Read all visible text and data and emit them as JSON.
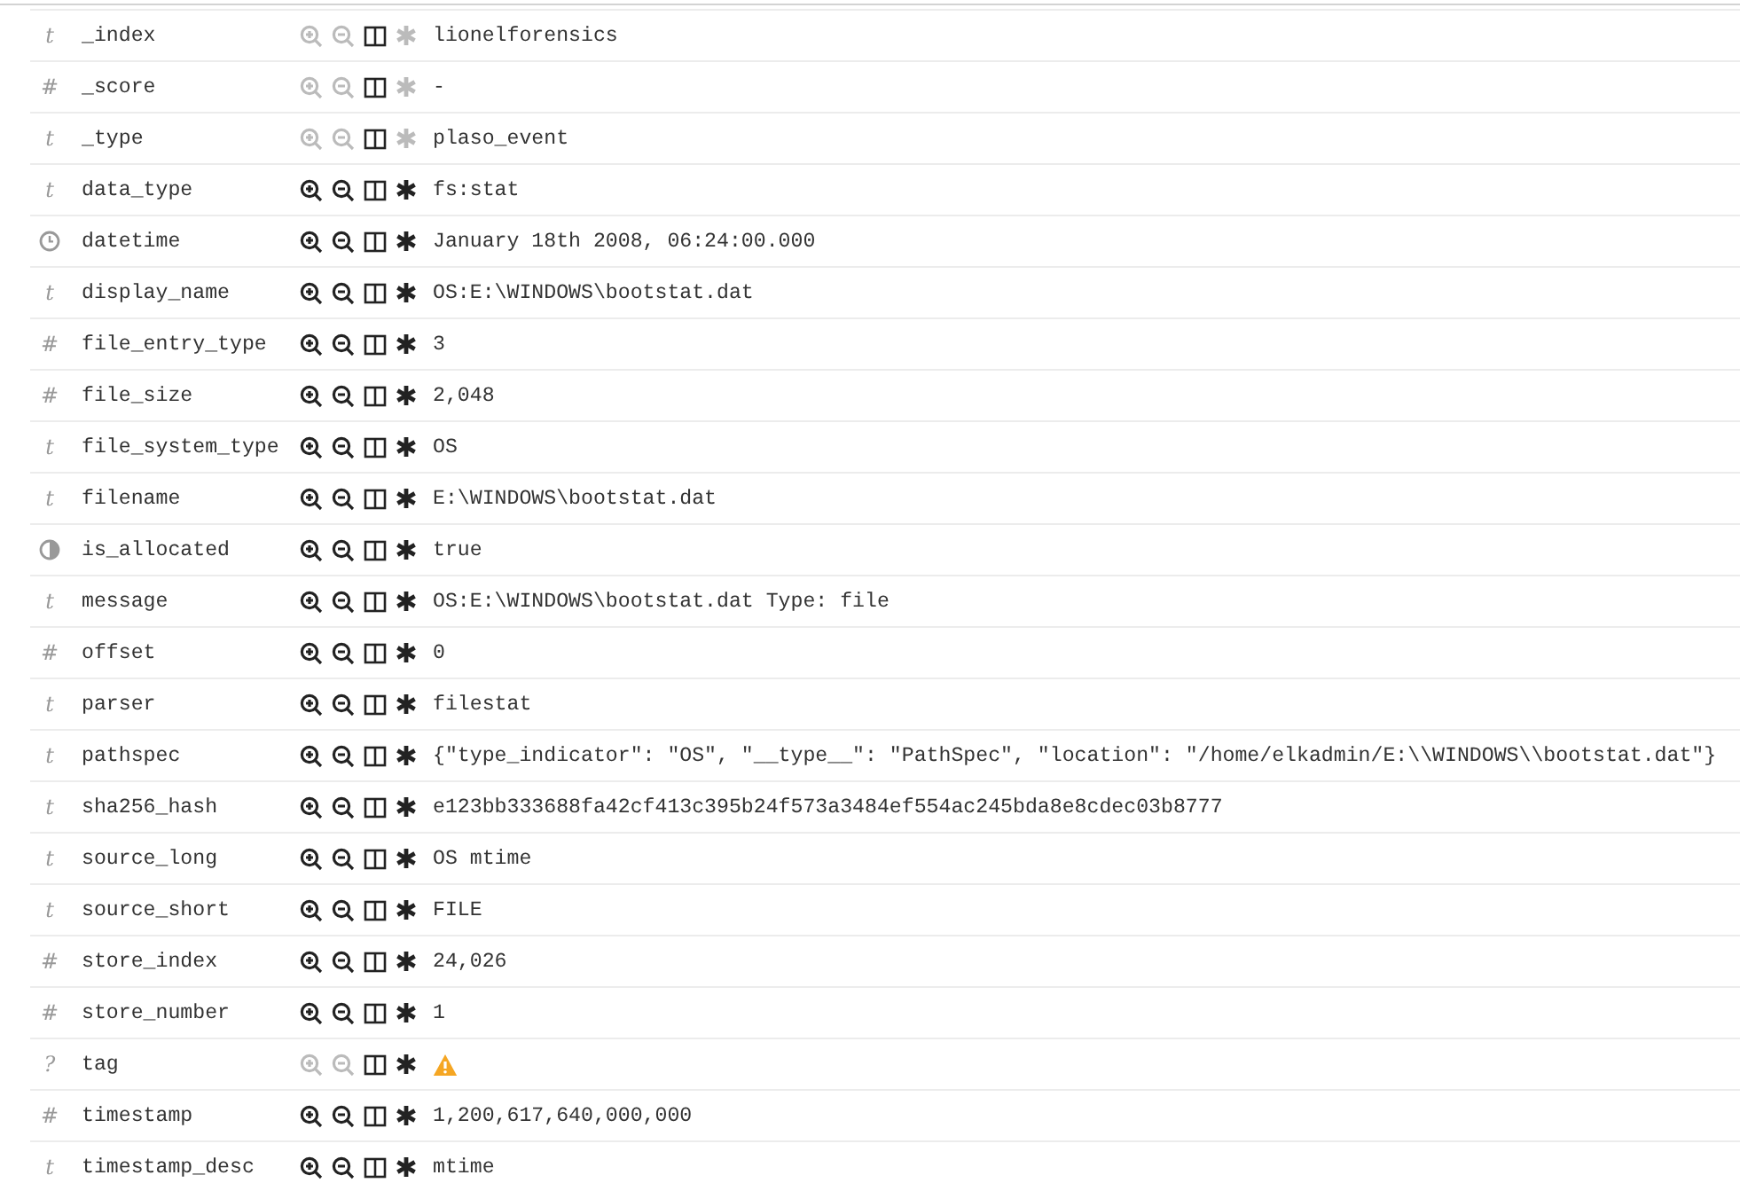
{
  "fields": [
    {
      "kind": "string",
      "type_label": "t",
      "name": "_index",
      "filter_disabled": true,
      "exists_disabled": true,
      "value": "lionelforensics"
    },
    {
      "kind": "number",
      "type_label": "#",
      "name": "_score",
      "filter_disabled": true,
      "exists_disabled": true,
      "value": "-"
    },
    {
      "kind": "string",
      "type_label": "t",
      "name": "_type",
      "filter_disabled": true,
      "exists_disabled": true,
      "value": "plaso_event"
    },
    {
      "kind": "string",
      "type_label": "t",
      "name": "data_type",
      "filter_disabled": false,
      "exists_disabled": false,
      "value": "fs:stat"
    },
    {
      "kind": "date",
      "name": "datetime",
      "filter_disabled": false,
      "exists_disabled": false,
      "value": "January 18th 2008, 06:24:00.000"
    },
    {
      "kind": "string",
      "type_label": "t",
      "name": "display_name",
      "filter_disabled": false,
      "exists_disabled": false,
      "value": "OS:E:\\WINDOWS\\bootstat.dat"
    },
    {
      "kind": "number",
      "type_label": "#",
      "name": "file_entry_type",
      "filter_disabled": false,
      "exists_disabled": false,
      "value": "3"
    },
    {
      "kind": "number",
      "type_label": "#",
      "name": "file_size",
      "filter_disabled": false,
      "exists_disabled": false,
      "value": "2,048"
    },
    {
      "kind": "string",
      "type_label": "t",
      "name": "file_system_type",
      "filter_disabled": false,
      "exists_disabled": false,
      "value": "OS"
    },
    {
      "kind": "string",
      "type_label": "t",
      "name": "filename",
      "filter_disabled": false,
      "exists_disabled": false,
      "value": "E:\\WINDOWS\\bootstat.dat"
    },
    {
      "kind": "boolean",
      "name": "is_allocated",
      "filter_disabled": false,
      "exists_disabled": false,
      "value": "true"
    },
    {
      "kind": "string",
      "type_label": "t",
      "name": "message",
      "filter_disabled": false,
      "exists_disabled": false,
      "value": "OS:E:\\WINDOWS\\bootstat.dat Type: file"
    },
    {
      "kind": "number",
      "type_label": "#",
      "name": "offset",
      "filter_disabled": false,
      "exists_disabled": false,
      "value": "0"
    },
    {
      "kind": "string",
      "type_label": "t",
      "name": "parser",
      "filter_disabled": false,
      "exists_disabled": false,
      "value": "filestat"
    },
    {
      "kind": "string",
      "type_label": "t",
      "name": "pathspec",
      "filter_disabled": false,
      "exists_disabled": false,
      "value": "{\"type_indicator\": \"OS\", \"__type__\": \"PathSpec\", \"location\": \"/home/elkadmin/E:\\\\WINDOWS\\\\bootstat.dat\"}"
    },
    {
      "kind": "string",
      "type_label": "t",
      "name": "sha256_hash",
      "filter_disabled": false,
      "exists_disabled": false,
      "value": "e123bb333688fa42cf413c395b24f573a3484ef554ac245bda8e8cdec03b8777"
    },
    {
      "kind": "string",
      "type_label": "t",
      "name": "source_long",
      "filter_disabled": false,
      "exists_disabled": false,
      "value": "OS mtime"
    },
    {
      "kind": "string",
      "type_label": "t",
      "name": "source_short",
      "filter_disabled": false,
      "exists_disabled": false,
      "value": "FILE"
    },
    {
      "kind": "number",
      "type_label": "#",
      "name": "store_index",
      "filter_disabled": false,
      "exists_disabled": false,
      "value": "24,026"
    },
    {
      "kind": "number",
      "type_label": "#",
      "name": "store_number",
      "filter_disabled": false,
      "exists_disabled": false,
      "value": "1"
    },
    {
      "kind": "unknown",
      "type_label": "?",
      "name": "tag",
      "filter_disabled": true,
      "exists_disabled": false,
      "warning": true
    },
    {
      "kind": "number",
      "type_label": "#",
      "name": "timestamp",
      "filter_disabled": false,
      "exists_disabled": false,
      "value": "1,200,617,640,000,000"
    },
    {
      "kind": "string",
      "type_label": "t",
      "name": "timestamp_desc",
      "filter_disabled": false,
      "exists_disabled": false,
      "value": "mtime"
    }
  ]
}
